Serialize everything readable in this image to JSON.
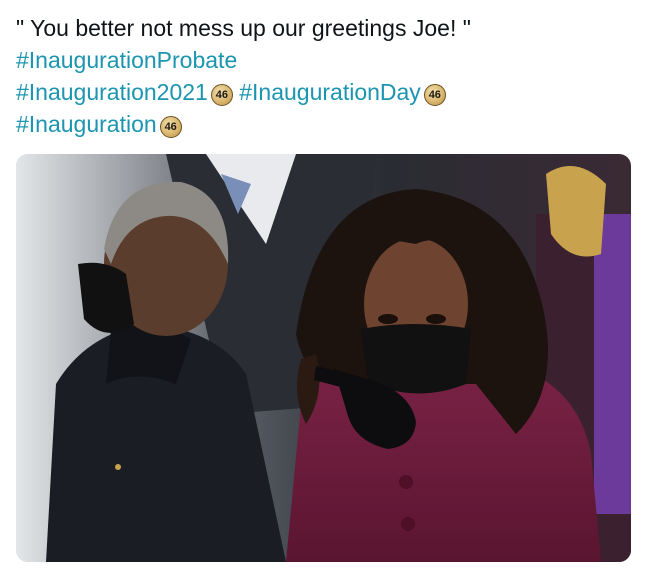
{
  "tweet": {
    "quote": "\" You better not mess up our greetings Joe! \"",
    "hashtags": {
      "probate": "#InaugurationProbate",
      "year": "#Inauguration2021",
      "day": "#InaugurationDay",
      "plain": "#Inauguration"
    },
    "badge_text": "46"
  },
  "photo": {
    "icon": "inauguration-photo",
    "colors": {
      "coat_plum": "#6b1a3a",
      "dark_coat": "#1a1d24",
      "mask": "#111111",
      "sky": "#cfd3d6"
    }
  }
}
